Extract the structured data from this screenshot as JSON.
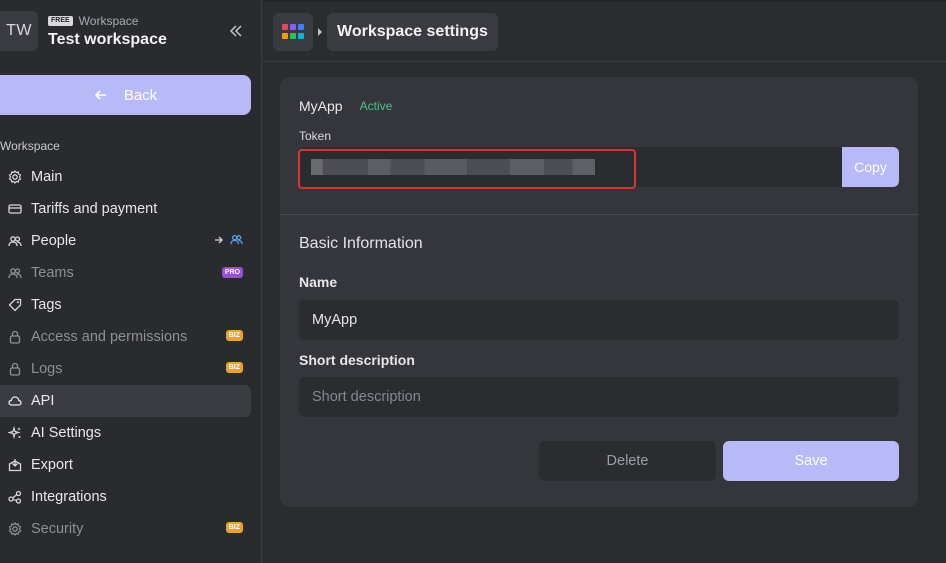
{
  "workspace": {
    "initials": "TW",
    "plan_badge": "FREE",
    "plan_label": "Workspace",
    "name": "Test workspace"
  },
  "sidebar": {
    "back_label": "Back",
    "section_title": "Workspace",
    "items": [
      {
        "label": "Main",
        "icon": "gear-icon"
      },
      {
        "label": "Tariffs and payment",
        "icon": "credit-card-icon"
      },
      {
        "label": "People",
        "icon": "people-icon"
      },
      {
        "label": "Teams",
        "icon": "team-icon",
        "tag": "PRO"
      },
      {
        "label": "Tags",
        "icon": "tag-icon"
      },
      {
        "label": "Access and permissions",
        "icon": "lock-icon",
        "tag": "BIZ"
      },
      {
        "label": "Logs",
        "icon": "lock-icon",
        "tag": "BIZ"
      },
      {
        "label": "API",
        "icon": "cloud-icon"
      },
      {
        "label": "AI Settings",
        "icon": "sparkle-icon"
      },
      {
        "label": "Export",
        "icon": "export-icon"
      },
      {
        "label": "Integrations",
        "icon": "integrations-icon"
      },
      {
        "label": "Security",
        "icon": "gear-icon",
        "tag": "BIZ"
      }
    ]
  },
  "topbar": {
    "title": "Workspace settings"
  },
  "app": {
    "name": "MyApp",
    "status": "Active",
    "token_label": "Token",
    "copy_label": "Copy"
  },
  "basic_info": {
    "heading": "Basic Information",
    "name_label": "Name",
    "name_value": "MyApp",
    "desc_label": "Short description",
    "desc_placeholder": "Short description"
  },
  "actions": {
    "delete_label": "Delete",
    "save_label": "Save"
  },
  "colors": {
    "accent": "#b8b9f7",
    "status_active": "#4cc38a",
    "pro_tag": "#9b4fd6",
    "biz_tag": "#e9a520",
    "highlight": "#d9352d"
  }
}
